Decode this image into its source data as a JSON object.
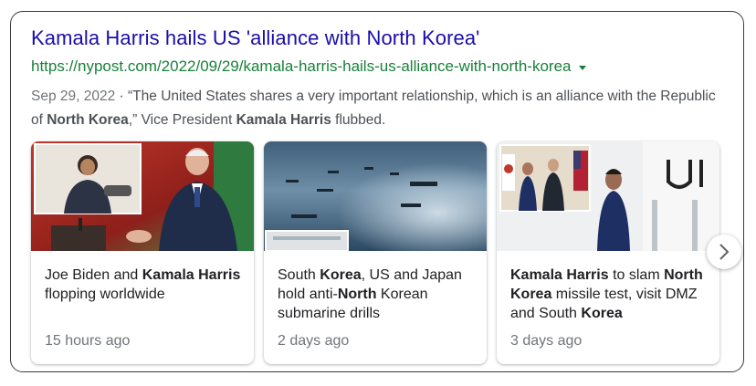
{
  "result": {
    "title": "Kamala Harris hails US 'alliance with North Korea'",
    "url": "https://nypost.com/2022/09/29/kamala-harris-hails-us-alliance-with-north-korea",
    "date": "Sep 29, 2022",
    "snippet_parts": [
      {
        "text": "“The United States shares a very important relationship, which is an alliance with the Republic of ",
        "bold": false
      },
      {
        "text": "North Korea",
        "bold": true
      },
      {
        "text": ",” Vice President ",
        "bold": false
      },
      {
        "text": "Kamala Harris",
        "bold": true
      },
      {
        "text": " flubbed.",
        "bold": false
      }
    ]
  },
  "news_cards": [
    {
      "headline_parts": [
        {
          "text": "Joe Biden and ",
          "bold": false
        },
        {
          "text": "Kamala Harris",
          "bold": true
        },
        {
          "text": " flopping worldwide",
          "bold": false
        }
      ],
      "time": "15 hours ago"
    },
    {
      "headline_parts": [
        {
          "text": "South ",
          "bold": false
        },
        {
          "text": "Korea",
          "bold": true
        },
        {
          "text": ", US and Japan hold anti-",
          "bold": false
        },
        {
          "text": "North",
          "bold": true
        },
        {
          "text": " Korean submarine drills",
          "bold": false
        }
      ],
      "time": "2 days ago"
    },
    {
      "headline_parts": [
        {
          "text": "Kamala Harris",
          "bold": true
        },
        {
          "text": " to slam ",
          "bold": false
        },
        {
          "text": "North Korea",
          "bold": true
        },
        {
          "text": " missile test, visit DMZ and South ",
          "bold": false
        },
        {
          "text": "Korea",
          "bold": true
        }
      ],
      "time": "3 days ago"
    }
  ],
  "icons": {
    "caret": "caret-down-icon",
    "next": "chevron-right-icon"
  },
  "colors": {
    "title": "#1a0dab",
    "url": "#188038",
    "snippet": "#4d5156",
    "muted": "#70757a"
  }
}
